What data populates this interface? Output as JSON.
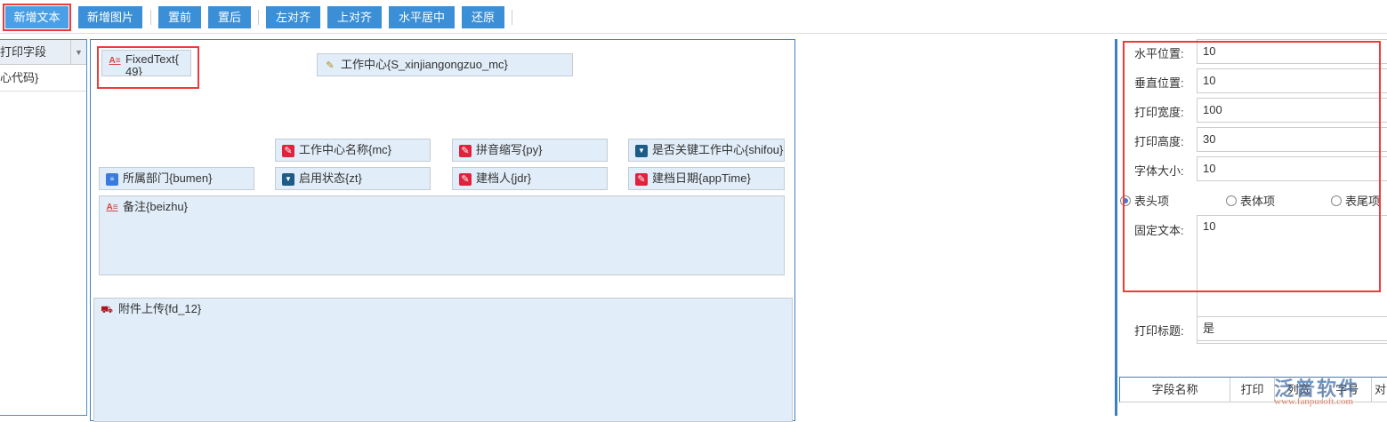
{
  "toolbar": {
    "buttons": [
      "新增文本",
      "新增图片",
      "置前",
      "置后",
      "左对齐",
      "上对齐",
      "水平居中",
      "还原"
    ]
  },
  "left_panel": {
    "header": "打印字段",
    "items": [
      "心代码}"
    ]
  },
  "canvas": {
    "fields": [
      {
        "label": "FixedText{\n49}",
        "icon": "fixed-text-icon"
      },
      {
        "label": "工作中心{S_xinjiangongzuo_mc}",
        "icon": "pen-icon"
      },
      {
        "label": "工作中心名称{mc}",
        "icon": "edit-icon"
      },
      {
        "label": "拼音缩写{py}",
        "icon": "edit-icon"
      },
      {
        "label": "是否关键工作中心{shifou}",
        "icon": "dropdown-icon"
      },
      {
        "label": "所属部门{bumen}",
        "icon": "document-icon"
      },
      {
        "label": "启用状态{zt}",
        "icon": "dropdown-icon"
      },
      {
        "label": "建档人{jdr}",
        "icon": "edit-icon"
      },
      {
        "label": "建档日期{appTime}",
        "icon": "edit-icon"
      },
      {
        "label": "备注{beizhu}",
        "icon": "text-icon"
      },
      {
        "label": "附件上传{fd_12}",
        "icon": "upload-icon"
      }
    ]
  },
  "properties": {
    "rows": [
      {
        "label": "水平位置:",
        "value": "10"
      },
      {
        "label": "垂直位置:",
        "value": "10"
      },
      {
        "label": "打印宽度:",
        "value": "100"
      },
      {
        "label": "打印高度:",
        "value": "30"
      },
      {
        "label": "字体大小:",
        "value": "10"
      }
    ],
    "radios": [
      {
        "label": "表头项",
        "checked": true
      },
      {
        "label": "表体项",
        "checked": false
      },
      {
        "label": "表尾项",
        "checked": false
      }
    ],
    "fixed_text_label": "固定文本:",
    "fixed_text_value": "10",
    "print_title_label": "打印标题:",
    "print_title_value": "是",
    "table_headers": [
      "字段名称",
      "打印",
      "列宽",
      "字号",
      "对"
    ]
  },
  "watermark": {
    "brand": "泛普软件",
    "url": "www.fanpusoft.com"
  },
  "colors": {
    "accent": "#3a8fd6",
    "highlight": "#f03a3a",
    "field_bg": "#e1edf8"
  }
}
